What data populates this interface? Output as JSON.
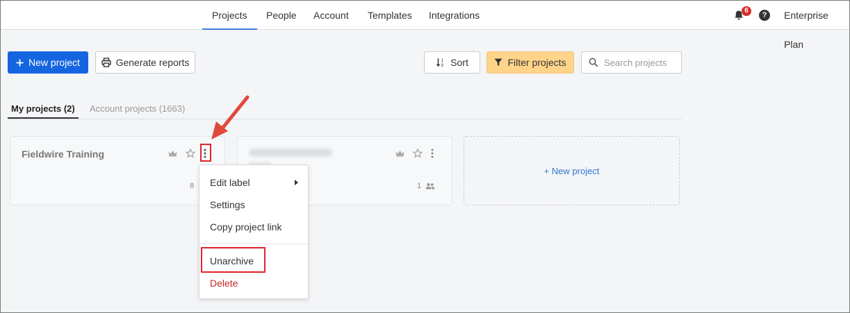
{
  "nav": {
    "tabs": [
      "Projects",
      "People",
      "Account",
      "Templates",
      "Integrations"
    ],
    "active_tab": "Projects",
    "notification_count": "6",
    "help_label": "?",
    "plan_label": "Enterprise Plan"
  },
  "toolbar": {
    "new_project_label": "New project",
    "generate_reports_label": "Generate reports",
    "sort_label": "Sort",
    "filter_label": "Filter projects",
    "search_placeholder": "Search projects",
    "search_value": ""
  },
  "subtabs": {
    "my_projects": "My projects (2)",
    "account_projects": "Account projects (1663)"
  },
  "cards": [
    {
      "title": "Fieldwire Training",
      "member_count": "8"
    },
    {
      "title": "",
      "member_count": "1"
    }
  ],
  "new_project_card_label": "+ New project",
  "menu": {
    "items": [
      "Edit label",
      "Settings",
      "Copy project link"
    ],
    "unarchive": "Unarchive",
    "delete": "Delete"
  },
  "colors": {
    "primary": "#1665e0",
    "filter_bg": "#ffd48a",
    "badge": "#d92b2b",
    "highlight": "#e0242b",
    "delete": "#c62828",
    "link": "#2f76d8"
  }
}
